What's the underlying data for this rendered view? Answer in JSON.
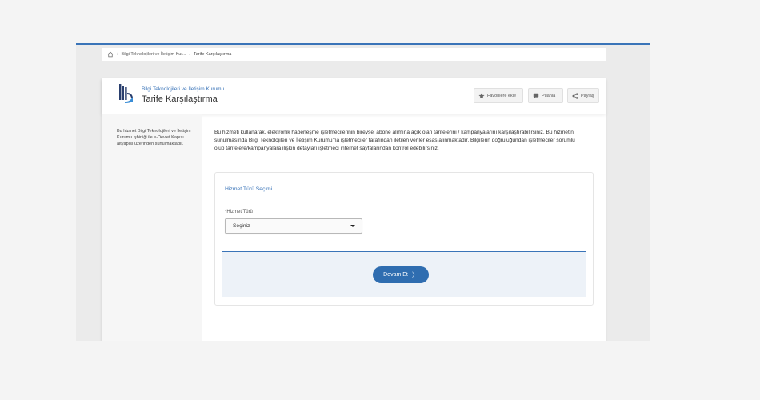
{
  "breadcrumb": {
    "org": "Bilgi Teknolojileri ve İletişim Kur...",
    "current": "Tarife Karşılaştırma"
  },
  "header": {
    "org_name": "Bilgi Teknolojileri ve İletişim Kurumu",
    "title": "Tarife Karşılaştırma",
    "favorite_label": "Favorilere ekle",
    "rate_label": "Puanla",
    "share_label": "Paylaş"
  },
  "sidebar": {
    "text": "Bu hizmet Bilgi Teknolojileri ve İletişim Kurumu işbirliği ile e-Devlet Kapısı altyapısı üzerinden sunulmaktadır."
  },
  "intro": {
    "text": "Bu hizmeti kullanarak, elektronik haberleşme işletmecilerinin bireysel abone alımına açık olan tarifelerini / kampanyalarını karşılaştırabilirsiniz. Bu hizmetin sunulmasında Bilgi Teknolojileri ve İletişim Kurumu'na işletmeciler tarafından iletilen veriler esas alınmaktadır. Bilgilerin doğruluğundan işletmeciler sorumlu olup tarifelere/kampanyalara ilişkin detayları işletmeci internet sayfalarından kontrol edebilirsiniz."
  },
  "form": {
    "section_title": "Hizmet Türü Seçimi",
    "field_label": "*Hizmet Türü",
    "select_value": "Seçiniz",
    "submit_label": "Devam Et"
  },
  "colors": {
    "accent": "#3a74b8",
    "button": "#2f6db0"
  },
  "icons": [
    "home-icon",
    "star-icon",
    "speech-bubble-icon",
    "share-icon",
    "chevron-right-icon",
    "logo"
  ]
}
